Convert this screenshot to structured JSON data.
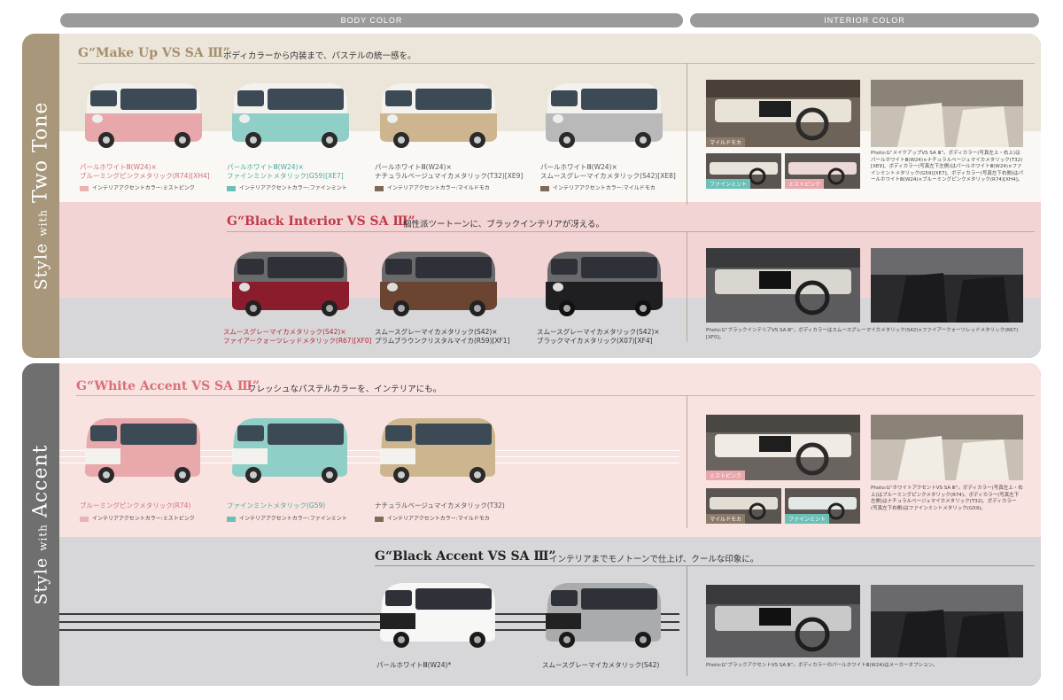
{
  "tabs": {
    "body_color": "BODY COLOR",
    "interior_color": "INTERIOR COLOR"
  },
  "colors": {
    "two_tone_side": "#a8977a",
    "accent_side": "#6f6f6f",
    "beige_band": "#ece5da",
    "pink_band": "#f3d4d4",
    "grey_band": "#d7d7d9",
    "light_pink_band": "#f8e3e0",
    "mint": "#6cc0b8",
    "pink": "#e8a7aa"
  },
  "two_tone": {
    "side_prefix": "Style",
    "side_with": "with",
    "side_name": "Two Tone",
    "makeup": {
      "title": "G“Make Up VS SA Ⅲ”",
      "subtitle": "ボディカラーから内装まで、パステルの統一感を。",
      "cars": [
        {
          "line1": "パールホワイトⅢ(W24)×",
          "line2": "ブルーミングピンクメタリック(R74)[XH4]",
          "accent": "インテリアアクセントカラー:ミストピンク"
        },
        {
          "line1": "パールホワイトⅢ(W24)×",
          "line2": "ファインミントメタリック(G59)[XE7]",
          "accent": "インテリアアクセントカラー:ファインミント"
        },
        {
          "line1": "パールホワイトⅢ(W24)×",
          "line2": "ナチュラルベージュマイカメタリック(T32)[XE9]",
          "accent": "インテリアアクセントカラー:マイルドモカ"
        },
        {
          "line1": "パールホワイトⅢ(W24)×",
          "line2": "スムースグレーマイカメタリック(S42)[XE8]",
          "accent": "インテリアアクセントカラー:マイルドモカ"
        }
      ],
      "interior_labels": [
        "マイルドモカ",
        "ファインミント",
        "ミストピンク"
      ],
      "note": "Photo:G“メイクアップVS SA Ⅲ”。ボディカラー(写真左上・右上)はパールホワイトⅢ(W24)×ナチュラルベージュマイカメタリック(T32)[XE9]、ボディカラー(写真左下左側)はパールホワイトⅢ(W24)×ファインミントメタリック(G59)[XE7]、ボディカラー(写真左下右側)はパールホワイトⅢ(W24)×ブルーミングピンクメタリック(R74)[XH4]。"
    },
    "black_interior": {
      "title": "G“Black Interior VS SA Ⅲ”",
      "subtitle": "個性派ツートーンに、ブラックインテリアが冴える。",
      "cars": [
        {
          "line1": "スムースグレーマイカメタリック(S42)×",
          "line2": "ファイアークォーツレッドメタリック(R67)[XF0]"
        },
        {
          "line1": "スムースグレーマイカメタリック(S42)×",
          "line2": "プラムブラウンクリスタルマイカ(R59)[XF1]"
        },
        {
          "line1": "スムースグレーマイカメタリック(S42)×",
          "line2": "ブラックマイカメタリック(X07)[XF4]"
        }
      ],
      "note": "Photo:G“ブラックインテリアVS SA Ⅲ”。ボディカラーはスムースグレーマイカメタリック(S42)×ファイアークォーツレッドメタリック(R67)[XF0]。"
    }
  },
  "accent": {
    "side_prefix": "Style",
    "side_with": "with",
    "side_name": "Accent",
    "white_accent": {
      "title": "G“White Accent VS SA Ⅲ”",
      "subtitle": "フレッシュなパステルカラーを、インテリアにも。",
      "cars": [
        {
          "line1": "ブルーミングピンクメタリック(R74)",
          "accent": "インテリアアクセントカラー:ミストピンク"
        },
        {
          "line1": "ファインミントメタリック(G59)",
          "accent": "インテリアアクセントカラー:ファインミント"
        },
        {
          "line1": "ナチュラルベージュマイカメタリック(T32)",
          "accent": "インテリアアクセントカラー:マイルドモカ"
        }
      ],
      "interior_labels": [
        "ミストピンク",
        "マイルドモカ",
        "ファインミント"
      ],
      "note": "Photo:G“ホワイトアクセントVS SA Ⅲ”。ボディカラー(写真左上・右上)はブルーミングピンクメタリック(R74)、ボディカラー(写真左下左側)はナチュラルベージュマイカメタリック(T32)、ボディカラー(写真左下右側)はファインミントメタリック(G59)。"
    },
    "black_accent": {
      "title": "G“Black Accent VS SA Ⅲ”",
      "subtitle": "インテリアまでモノトーンで仕上げ、クールな印象に。",
      "cars": [
        {
          "line1": "パールホワイトⅢ(W24)*"
        },
        {
          "line1": "スムースグレーマイカメタリック(S42)"
        }
      ],
      "note": "Photo:G“ブラックアクセントVS SA Ⅲ”。ボディカラーのパールホワイトⅢ(W24)はメーカーオプション。"
    }
  }
}
